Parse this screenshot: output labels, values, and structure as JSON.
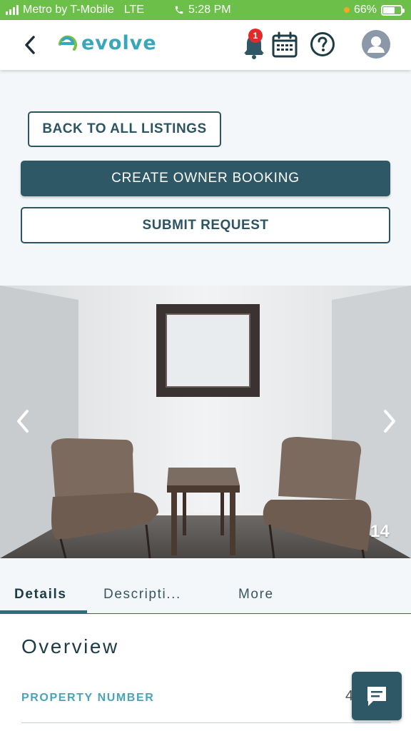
{
  "status_bar": {
    "carrier": "Metro by T-Mobile",
    "network": "LTE",
    "time": "5:28 PM",
    "battery": "66%",
    "battery_level": 0.66,
    "bar_color": "#6cc04a"
  },
  "header": {
    "logo_text": "evolve",
    "notification_count": "1",
    "icons": [
      "chevron-left-icon",
      "bell-icon",
      "calendar-icon",
      "help-icon",
      "user-avatar-icon"
    ],
    "brand_color": "#3aa6b9"
  },
  "actions": {
    "back_to_listings": "BACK TO ALL LISTINGS",
    "create_owner_booking": "CREATE OWNER BOOKING",
    "submit_request": "SUBMIT REQUEST",
    "primary_color": "#2e5866"
  },
  "gallery": {
    "photo_number": "14",
    "icons": [
      "chevron-left-icon",
      "chevron-right-icon"
    ]
  },
  "tabs": [
    {
      "label": "Details",
      "active": true
    },
    {
      "label": "Descripti...",
      "active": false
    },
    {
      "label": "More",
      "active": false
    }
  ],
  "overview": {
    "title": "Overview",
    "property_number_label": "PROPERTY NUMBER",
    "property_number_value": "4"
  },
  "chat": {
    "icon": "chat-icon"
  }
}
